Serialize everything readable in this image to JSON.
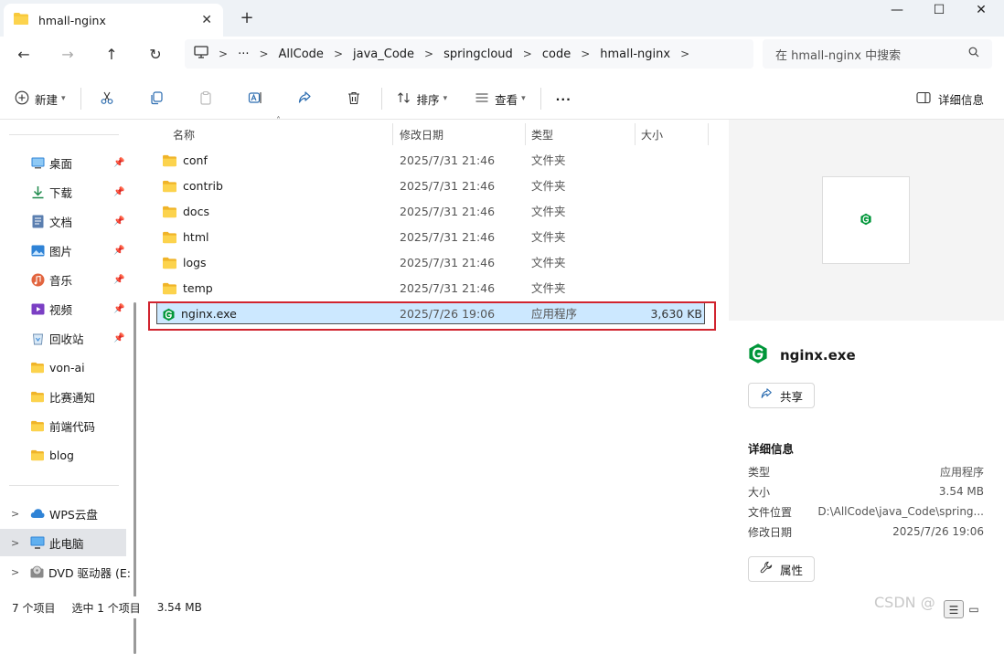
{
  "window": {
    "tab_title": "hmall-nginx",
    "close_tab": "✕",
    "new_tab": "+",
    "min": "—",
    "max": "☐",
    "close": "✕"
  },
  "nav": {
    "back": "←",
    "forward": "→",
    "up": "↑",
    "refresh": "↻",
    "more": "···"
  },
  "breadcrumb": [
    "AllCode",
    "java_Code",
    "springcloud",
    "code",
    "hmall-nginx"
  ],
  "search": {
    "placeholder": "在 hmall-nginx 中搜索"
  },
  "toolbar": {
    "new": "新建",
    "sort": "排序",
    "view": "查看",
    "more": "···",
    "details": "详细信息"
  },
  "sidebar": {
    "quick": [
      {
        "label": "桌面",
        "icon": "desktop-icon"
      },
      {
        "label": "下载",
        "icon": "download-icon"
      },
      {
        "label": "文档",
        "icon": "document-icon"
      },
      {
        "label": "图片",
        "icon": "pictures-icon"
      },
      {
        "label": "音乐",
        "icon": "music-icon"
      },
      {
        "label": "视频",
        "icon": "video-icon"
      },
      {
        "label": "回收站",
        "icon": "recycle-bin-icon"
      },
      {
        "label": "von-ai",
        "icon": "folder-icon"
      },
      {
        "label": "比赛通知",
        "icon": "folder-icon"
      },
      {
        "label": "前端代码",
        "icon": "folder-icon"
      },
      {
        "label": "blog",
        "icon": "folder-icon"
      }
    ],
    "drives": [
      {
        "label": "WPS云盘",
        "icon": "cloud-icon"
      },
      {
        "label": "此电脑",
        "icon": "computer-icon"
      },
      {
        "label": "DVD 驱动器 (E:",
        "icon": "dvd-icon"
      }
    ]
  },
  "columns": {
    "name": "名称",
    "date": "修改日期",
    "type": "类型",
    "size": "大小"
  },
  "files": [
    {
      "name": "conf",
      "date": "2025/7/31 21:46",
      "type": "文件夹",
      "size": "",
      "icon": "folder-icon"
    },
    {
      "name": "contrib",
      "date": "2025/7/31 21:46",
      "type": "文件夹",
      "size": "",
      "icon": "folder-icon"
    },
    {
      "name": "docs",
      "date": "2025/7/31 21:46",
      "type": "文件夹",
      "size": "",
      "icon": "folder-icon"
    },
    {
      "name": "html",
      "date": "2025/7/31 21:46",
      "type": "文件夹",
      "size": "",
      "icon": "folder-icon"
    },
    {
      "name": "logs",
      "date": "2025/7/31 21:46",
      "type": "文件夹",
      "size": "",
      "icon": "folder-icon"
    },
    {
      "name": "temp",
      "date": "2025/7/31 21:46",
      "type": "文件夹",
      "size": "",
      "icon": "folder-icon"
    },
    {
      "name": "nginx.exe",
      "date": "2025/7/26 19:06",
      "type": "应用程序",
      "size": "3,630 KB",
      "icon": "nginx-icon"
    }
  ],
  "details": {
    "filename": "nginx.exe",
    "share": "共享",
    "section": "详细信息",
    "props": [
      {
        "k": "类型",
        "v": "应用程序"
      },
      {
        "k": "大小",
        "v": "3.54 MB"
      },
      {
        "k": "文件位置",
        "v": "D:\\AllCode\\java_Code\\spring..."
      },
      {
        "k": "修改日期",
        "v": "2025/7/26 19:06"
      }
    ],
    "properties": "属性"
  },
  "status": {
    "count": "7 个项目",
    "selected": "选中 1 个项目",
    "size": "3.54 MB"
  },
  "watermark": "CSDN @",
  "colors": {
    "accent": "#0067c0",
    "selection": "#cce8ff",
    "highlight": "#d1242f",
    "folder": "#f8c93b",
    "nginx": "#009639"
  }
}
